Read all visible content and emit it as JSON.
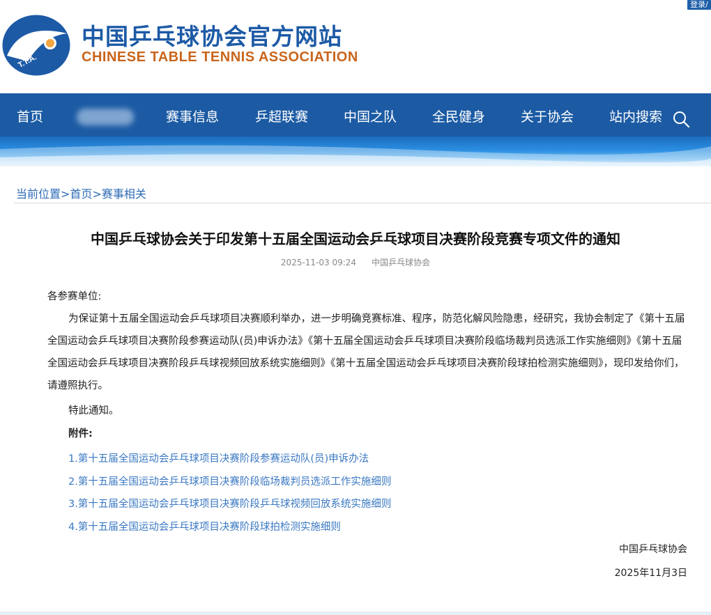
{
  "header": {
    "login_label": "登录/",
    "site_title": "中国乒乓球协会官方网站",
    "site_subtitle": "CHINESE TABLE TENNIS ASSOCIATION",
    "logo_text": "T.T.A.",
    "colors": {
      "brand_blue": "#1d5aa6",
      "brand_orange": "#c8651c"
    }
  },
  "nav": {
    "items": [
      {
        "label": "首页"
      },
      {
        "label": "赛事信息"
      },
      {
        "label": "乒超联赛"
      },
      {
        "label": "中国之队"
      },
      {
        "label": "全民健身"
      },
      {
        "label": "关于协会"
      },
      {
        "label": "站内搜索"
      }
    ],
    "search_icon": "search-icon"
  },
  "breadcrumb": {
    "prefix": "当前位置>",
    "home": "首页",
    "sep": ">",
    "current": "赛事相关"
  },
  "article": {
    "title": "中国乒乓球协会关于印发第十五届全国运动会乒乓球项目决赛阶段竞赛专项文件的通知",
    "date": "2025-11-03 09:24",
    "source": "中国乒乓球协会",
    "salutation": "各参赛单位:",
    "paragraph": "为保证第十五届全国运动会乒乓球项目决赛顺利举办，进一步明确竞赛标准、程序，防范化解风险隐患，经研究，我协会制定了《第十五届全国运动会乒乓球项目决赛阶段参赛运动队(员)申诉办法》《第十五届全国运动会乒乓球项目决赛阶段临场裁判员选派工作实施细则》《第十五届全国运动会乒乓球项目决赛阶段乒乓球视频回放系统实施细则》《第十五届全国运动会乒乓球项目决赛阶段球拍检测实施细则》，现印发给你们，请遵照执行。",
    "notice": "特此通知。",
    "attachments_label": "附件:",
    "attachments": [
      "1.第十五届全国运动会乒乓球项目决赛阶段参赛运动队(员)申诉办法",
      "2.第十五届全国运动会乒乓球项目决赛阶段临场裁判员选派工作实施细则",
      "3.第十五届全国运动会乒乓球项目决赛阶段乒乓球视频回放系统实施细则",
      "4.第十五届全国运动会乒乓球项目决赛阶段球拍检测实施细则"
    ],
    "signature": "中国乒乓球协会",
    "sign_date": "2025年11月3日"
  }
}
